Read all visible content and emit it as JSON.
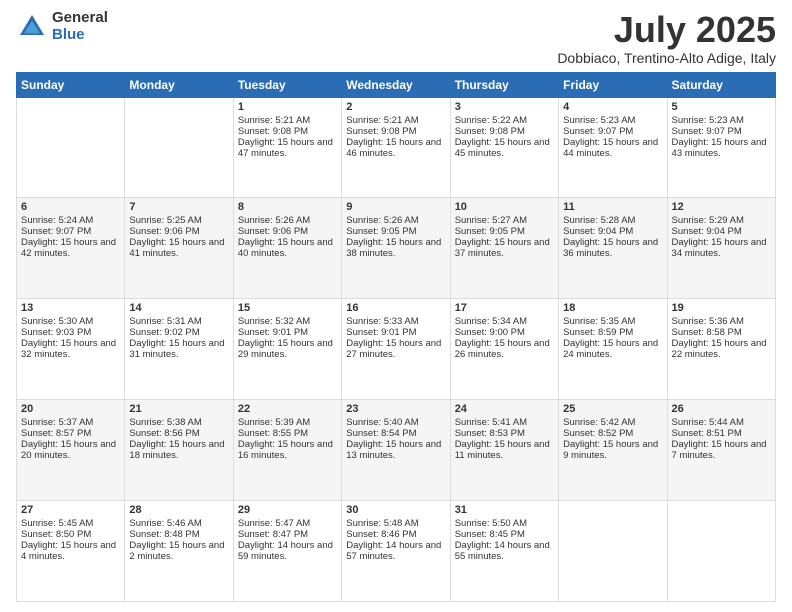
{
  "logo": {
    "general": "General",
    "blue": "Blue"
  },
  "title": "July 2025",
  "location": "Dobbiaco, Trentino-Alto Adige, Italy",
  "days_header": [
    "Sunday",
    "Monday",
    "Tuesday",
    "Wednesday",
    "Thursday",
    "Friday",
    "Saturday"
  ],
  "weeks": [
    [
      {
        "day": "",
        "info": ""
      },
      {
        "day": "",
        "info": ""
      },
      {
        "day": "1",
        "info": "Sunrise: 5:21 AM\nSunset: 9:08 PM\nDaylight: 15 hours and 47 minutes."
      },
      {
        "day": "2",
        "info": "Sunrise: 5:21 AM\nSunset: 9:08 PM\nDaylight: 15 hours and 46 minutes."
      },
      {
        "day": "3",
        "info": "Sunrise: 5:22 AM\nSunset: 9:08 PM\nDaylight: 15 hours and 45 minutes."
      },
      {
        "day": "4",
        "info": "Sunrise: 5:23 AM\nSunset: 9:07 PM\nDaylight: 15 hours and 44 minutes."
      },
      {
        "day": "5",
        "info": "Sunrise: 5:23 AM\nSunset: 9:07 PM\nDaylight: 15 hours and 43 minutes."
      }
    ],
    [
      {
        "day": "6",
        "info": "Sunrise: 5:24 AM\nSunset: 9:07 PM\nDaylight: 15 hours and 42 minutes."
      },
      {
        "day": "7",
        "info": "Sunrise: 5:25 AM\nSunset: 9:06 PM\nDaylight: 15 hours and 41 minutes."
      },
      {
        "day": "8",
        "info": "Sunrise: 5:26 AM\nSunset: 9:06 PM\nDaylight: 15 hours and 40 minutes."
      },
      {
        "day": "9",
        "info": "Sunrise: 5:26 AM\nSunset: 9:05 PM\nDaylight: 15 hours and 38 minutes."
      },
      {
        "day": "10",
        "info": "Sunrise: 5:27 AM\nSunset: 9:05 PM\nDaylight: 15 hours and 37 minutes."
      },
      {
        "day": "11",
        "info": "Sunrise: 5:28 AM\nSunset: 9:04 PM\nDaylight: 15 hours and 36 minutes."
      },
      {
        "day": "12",
        "info": "Sunrise: 5:29 AM\nSunset: 9:04 PM\nDaylight: 15 hours and 34 minutes."
      }
    ],
    [
      {
        "day": "13",
        "info": "Sunrise: 5:30 AM\nSunset: 9:03 PM\nDaylight: 15 hours and 32 minutes."
      },
      {
        "day": "14",
        "info": "Sunrise: 5:31 AM\nSunset: 9:02 PM\nDaylight: 15 hours and 31 minutes."
      },
      {
        "day": "15",
        "info": "Sunrise: 5:32 AM\nSunset: 9:01 PM\nDaylight: 15 hours and 29 minutes."
      },
      {
        "day": "16",
        "info": "Sunrise: 5:33 AM\nSunset: 9:01 PM\nDaylight: 15 hours and 27 minutes."
      },
      {
        "day": "17",
        "info": "Sunrise: 5:34 AM\nSunset: 9:00 PM\nDaylight: 15 hours and 26 minutes."
      },
      {
        "day": "18",
        "info": "Sunrise: 5:35 AM\nSunset: 8:59 PM\nDaylight: 15 hours and 24 minutes."
      },
      {
        "day": "19",
        "info": "Sunrise: 5:36 AM\nSunset: 8:58 PM\nDaylight: 15 hours and 22 minutes."
      }
    ],
    [
      {
        "day": "20",
        "info": "Sunrise: 5:37 AM\nSunset: 8:57 PM\nDaylight: 15 hours and 20 minutes."
      },
      {
        "day": "21",
        "info": "Sunrise: 5:38 AM\nSunset: 8:56 PM\nDaylight: 15 hours and 18 minutes."
      },
      {
        "day": "22",
        "info": "Sunrise: 5:39 AM\nSunset: 8:55 PM\nDaylight: 15 hours and 16 minutes."
      },
      {
        "day": "23",
        "info": "Sunrise: 5:40 AM\nSunset: 8:54 PM\nDaylight: 15 hours and 13 minutes."
      },
      {
        "day": "24",
        "info": "Sunrise: 5:41 AM\nSunset: 8:53 PM\nDaylight: 15 hours and 11 minutes."
      },
      {
        "day": "25",
        "info": "Sunrise: 5:42 AM\nSunset: 8:52 PM\nDaylight: 15 hours and 9 minutes."
      },
      {
        "day": "26",
        "info": "Sunrise: 5:44 AM\nSunset: 8:51 PM\nDaylight: 15 hours and 7 minutes."
      }
    ],
    [
      {
        "day": "27",
        "info": "Sunrise: 5:45 AM\nSunset: 8:50 PM\nDaylight: 15 hours and 4 minutes."
      },
      {
        "day": "28",
        "info": "Sunrise: 5:46 AM\nSunset: 8:48 PM\nDaylight: 15 hours and 2 minutes."
      },
      {
        "day": "29",
        "info": "Sunrise: 5:47 AM\nSunset: 8:47 PM\nDaylight: 14 hours and 59 minutes."
      },
      {
        "day": "30",
        "info": "Sunrise: 5:48 AM\nSunset: 8:46 PM\nDaylight: 14 hours and 57 minutes."
      },
      {
        "day": "31",
        "info": "Sunrise: 5:50 AM\nSunset: 8:45 PM\nDaylight: 14 hours and 55 minutes."
      },
      {
        "day": "",
        "info": ""
      },
      {
        "day": "",
        "info": ""
      }
    ]
  ]
}
